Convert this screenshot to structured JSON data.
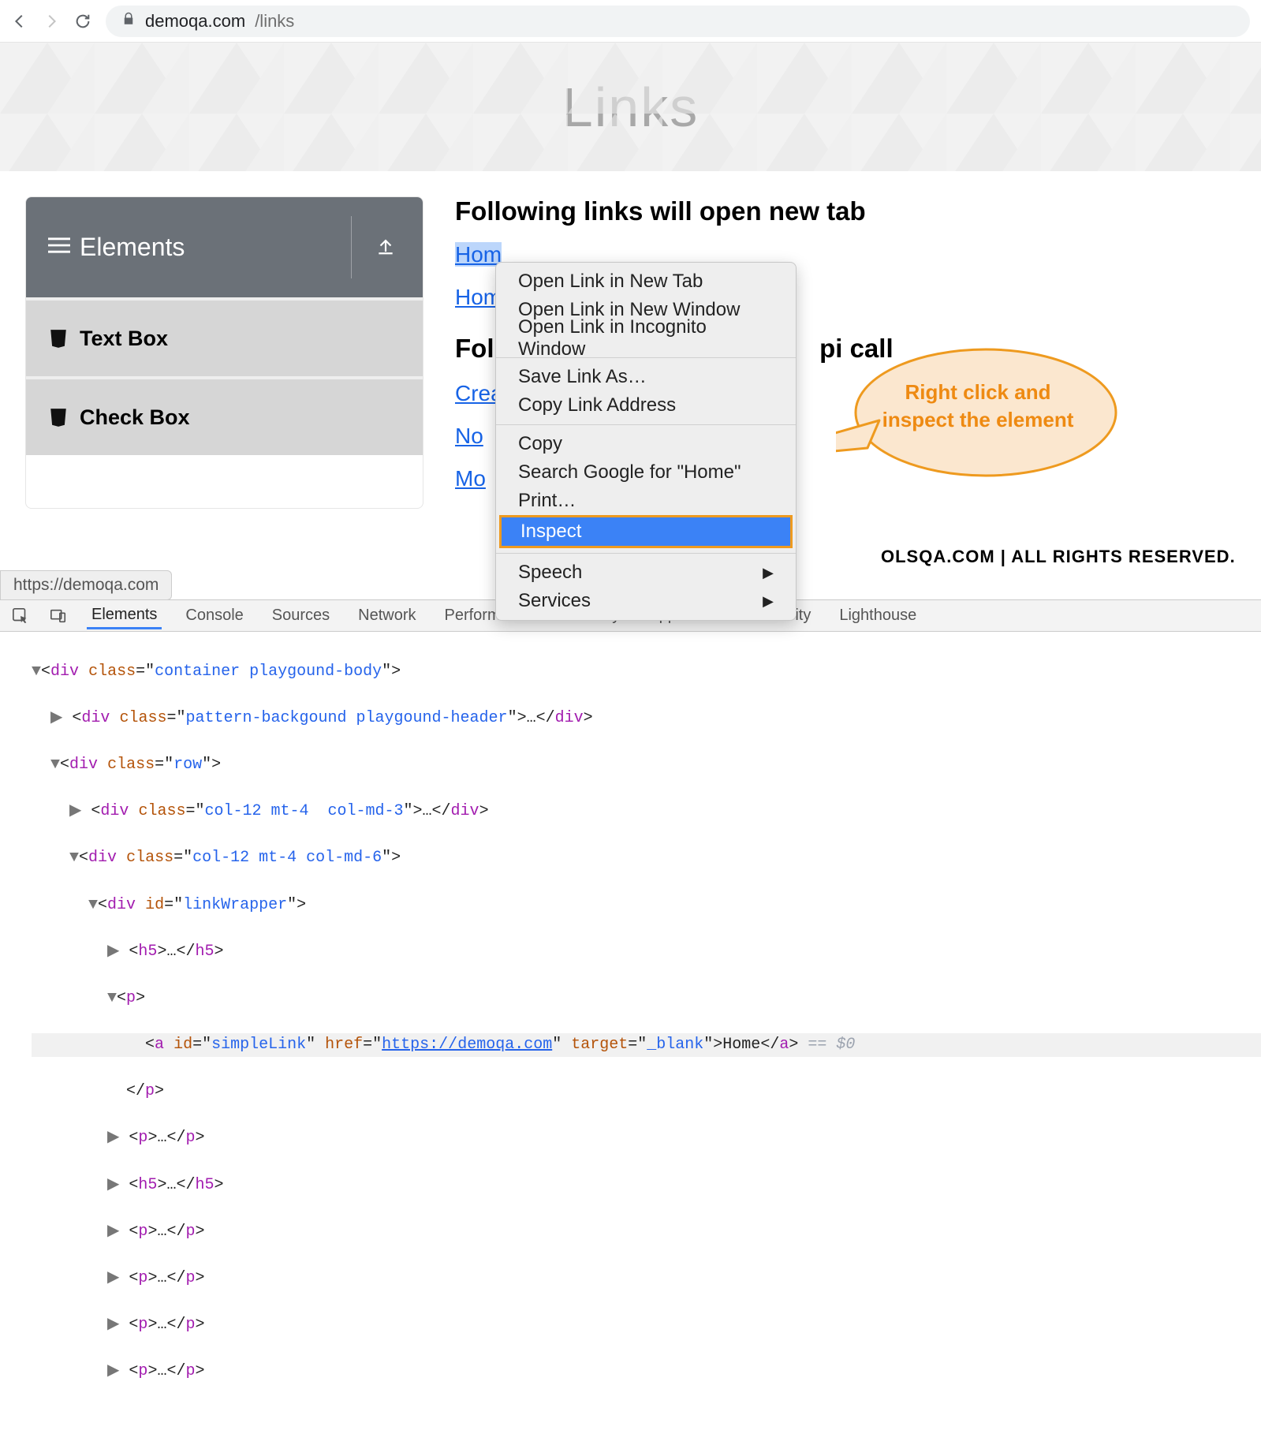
{
  "browser": {
    "url_host": "demoqa.com",
    "url_path": "/links"
  },
  "banner": {
    "title": "Links"
  },
  "sidebar": {
    "header_label": "Elements",
    "items": [
      {
        "label": "Text Box"
      },
      {
        "label": "Check Box"
      }
    ]
  },
  "main": {
    "heading1": "Following links will open new tab",
    "link_home1": "Hom",
    "link_home2": "Hom",
    "heading2_prefix": "Fol",
    "heading2_suffix": "pi call",
    "link_crea": "Crea",
    "link_no": "No",
    "link_mo": "Mo"
  },
  "footer_fragment": "OLSQA.COM | ALL RIGHTS RESERVED.",
  "context_menu": {
    "items_top": [
      "Open Link in New Tab",
      "Open Link in New Window",
      "Open Link in Incognito Window"
    ],
    "items_mid1": [
      "Save Link As…",
      "Copy Link Address"
    ],
    "items_mid2": [
      "Copy",
      "Search Google for \"Home\"",
      "Print…"
    ],
    "inspect": "Inspect",
    "items_bottom": [
      {
        "label": "Speech",
        "submenu": true
      },
      {
        "label": "Services",
        "submenu": true
      }
    ]
  },
  "callout": {
    "line1": "Right click and",
    "line2": "inspect the element"
  },
  "status_tooltip": "https://demoqa.com",
  "devtools": {
    "tabs": [
      "Elements",
      "Console",
      "Sources",
      "Network",
      "Performance",
      "Memory",
      "Application",
      "Security",
      "Lighthouse"
    ],
    "dom": {
      "l1_class": "container playgound-body",
      "l2_class": "pattern-backgound playgound-header",
      "l3_class": "row",
      "l4_class": "col-12 mt-4  col-md-3",
      "l5_class": "col-12 mt-4 col-md-6",
      "l6_id": "linkWrapper",
      "anchor_id": "simpleLink",
      "anchor_href": "https://demoqa.com",
      "anchor_target": "_blank",
      "anchor_text": "Home",
      "eq": " == $0"
    }
  }
}
